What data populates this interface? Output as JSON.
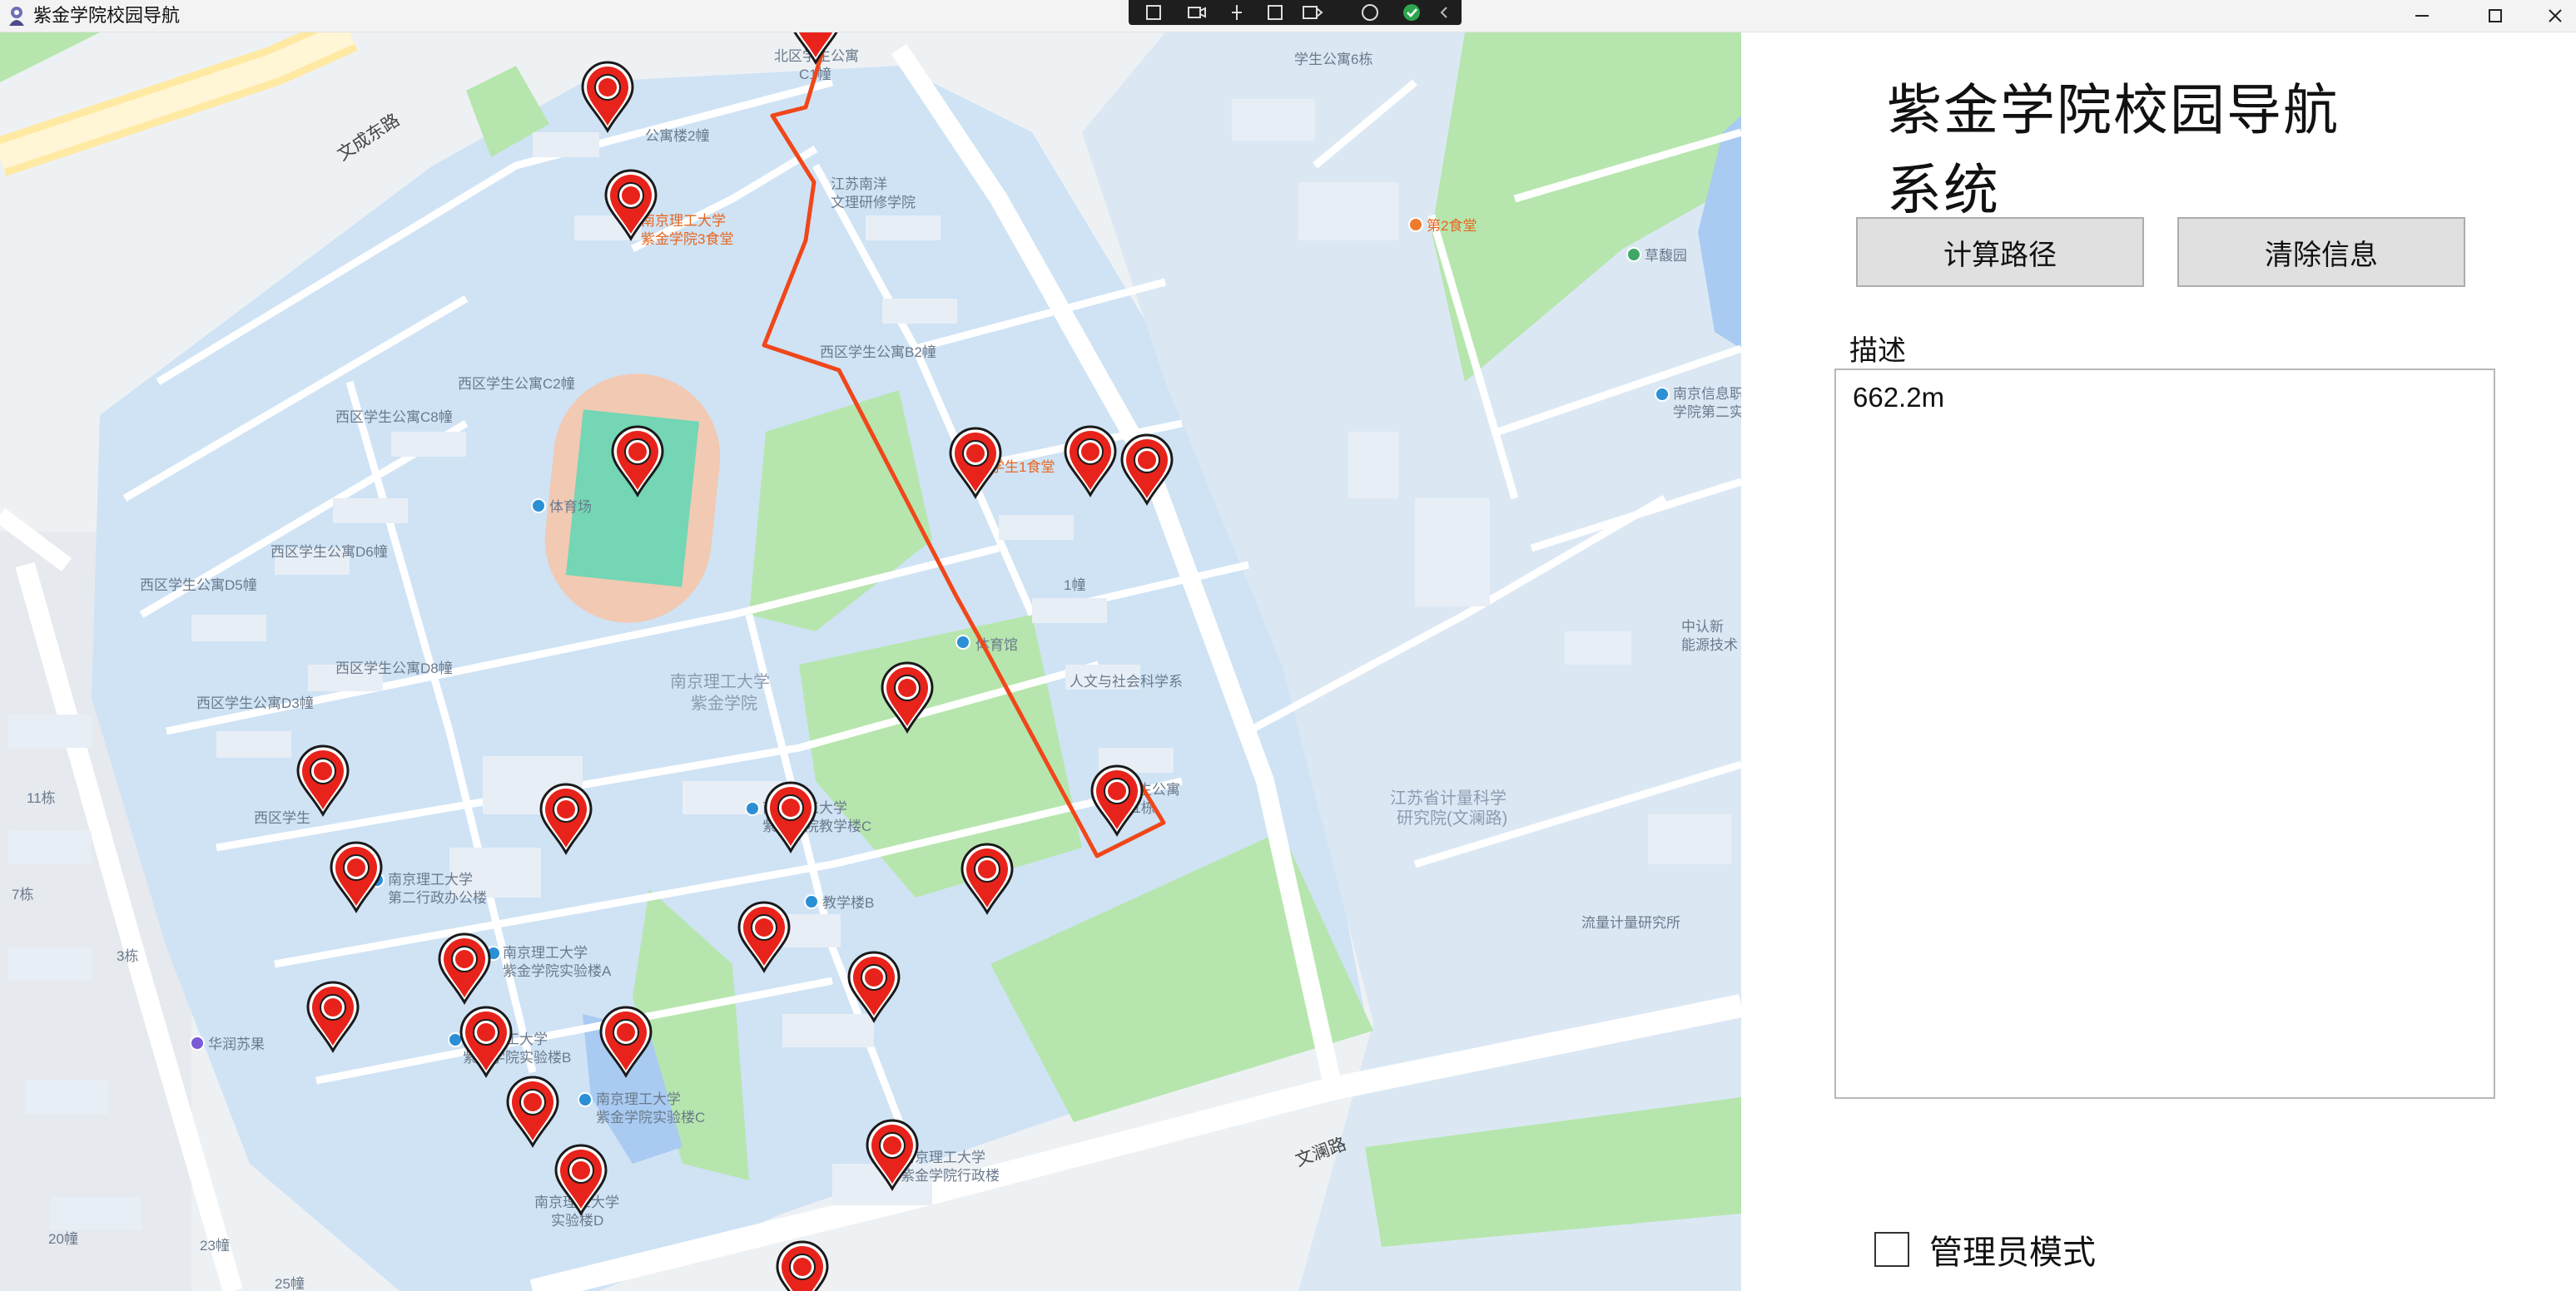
{
  "window": {
    "title": "紫金学院校园导航",
    "controls": [
      "minimize",
      "maximize",
      "close"
    ]
  },
  "panel": {
    "heading": "紫金学院校园导航系统",
    "buttons": {
      "calculate": "计算路径",
      "clear": "清除信息"
    },
    "description_label": "描述",
    "description_text": "662.2m",
    "admin_mode_label": "管理员模式",
    "admin_mode_checked": false
  },
  "map": {
    "roads": {
      "wencheng_east": "文成东路",
      "wenlan": "文澜路"
    },
    "labels": {
      "dorm_north_c1": "北区学生公寓",
      "dorm_c1_num": "C1幢",
      "dorm_2": "公寓楼2幢",
      "wenli_institute_1": "江苏南洋",
      "wenli_institute_2": "文理研修学院",
      "canteen3_1": "南京理工大学",
      "canteen3_2": "紫金学院3食堂",
      "dorm_b2": "西区学生公寓B2幢",
      "dorm_c2": "西区学生公寓C2幢",
      "dorm_c8": "西区学生公寓C8幢",
      "stadium": "体育场",
      "dorm_d6": "西区学生公寓D6幢",
      "dorm_d5": "西区学生公寓D5幢",
      "dorm_d8": "西区学生公寓D8幢",
      "dorm_d3": "西区学生公寓D3幢",
      "canteen1": "学生1食堂",
      "building_1": "1幢",
      "gym": "体育馆",
      "humanities": "人文与社会科学系",
      "campus_1": "南京理工大学",
      "campus_2": "紫金学院",
      "dorm_a1_1": "学生公寓",
      "dorm_a1_2": "A1栋",
      "dorm_west_small": "西区学生",
      "admin2_1": "南京理工大学",
      "admin2_2": "第二行政办公楼",
      "teach_c_1": "南京理工大学",
      "teach_c_2": "紫金学院教学楼C",
      "teach_b": "教学楼B",
      "lab_a_1": "南京理工大学",
      "lab_a_2": "紫金学院实验楼A",
      "lab_b_1": "南京理工大学",
      "lab_b_2": "紫金学院实验楼B",
      "lab_c_1": "南京理工大学",
      "lab_c_2": "紫金学院实验楼C",
      "lab_d_1": "南京理工大学",
      "lab_d_2": "实验楼D",
      "admin_1": "南京理工大学",
      "admin_2": "紫金学院行政楼",
      "huarun": "华润苏果",
      "dorm_6": "学生公寓6栋",
      "canteen2": "第2食堂",
      "caozhuyuan": "草馥园",
      "nuist_1": "南京信息职",
      "nuist_2": "学院第二实",
      "zhongrenxin_1": "中认新",
      "zhongrenxin_2": "能源技术",
      "metrology_1": "江苏省计量科学",
      "metrology_2": "研究院(文澜路)",
      "flow_metrology": "流量计量研究所",
      "b11": "11栋",
      "b7": "7栋",
      "b3": "3栋",
      "b20": "20幢",
      "b23": "23幢",
      "b25": "25幢"
    },
    "route_distance": "662.2m"
  },
  "colors": {
    "route": "#f0471a",
    "pin_fill": "#e8231b",
    "pin_outline": "#1a1a1a",
    "water": "#cfe3f5",
    "green": "#b6e6ad",
    "road": "#ffffff",
    "button_bg": "#e0e0e0"
  }
}
